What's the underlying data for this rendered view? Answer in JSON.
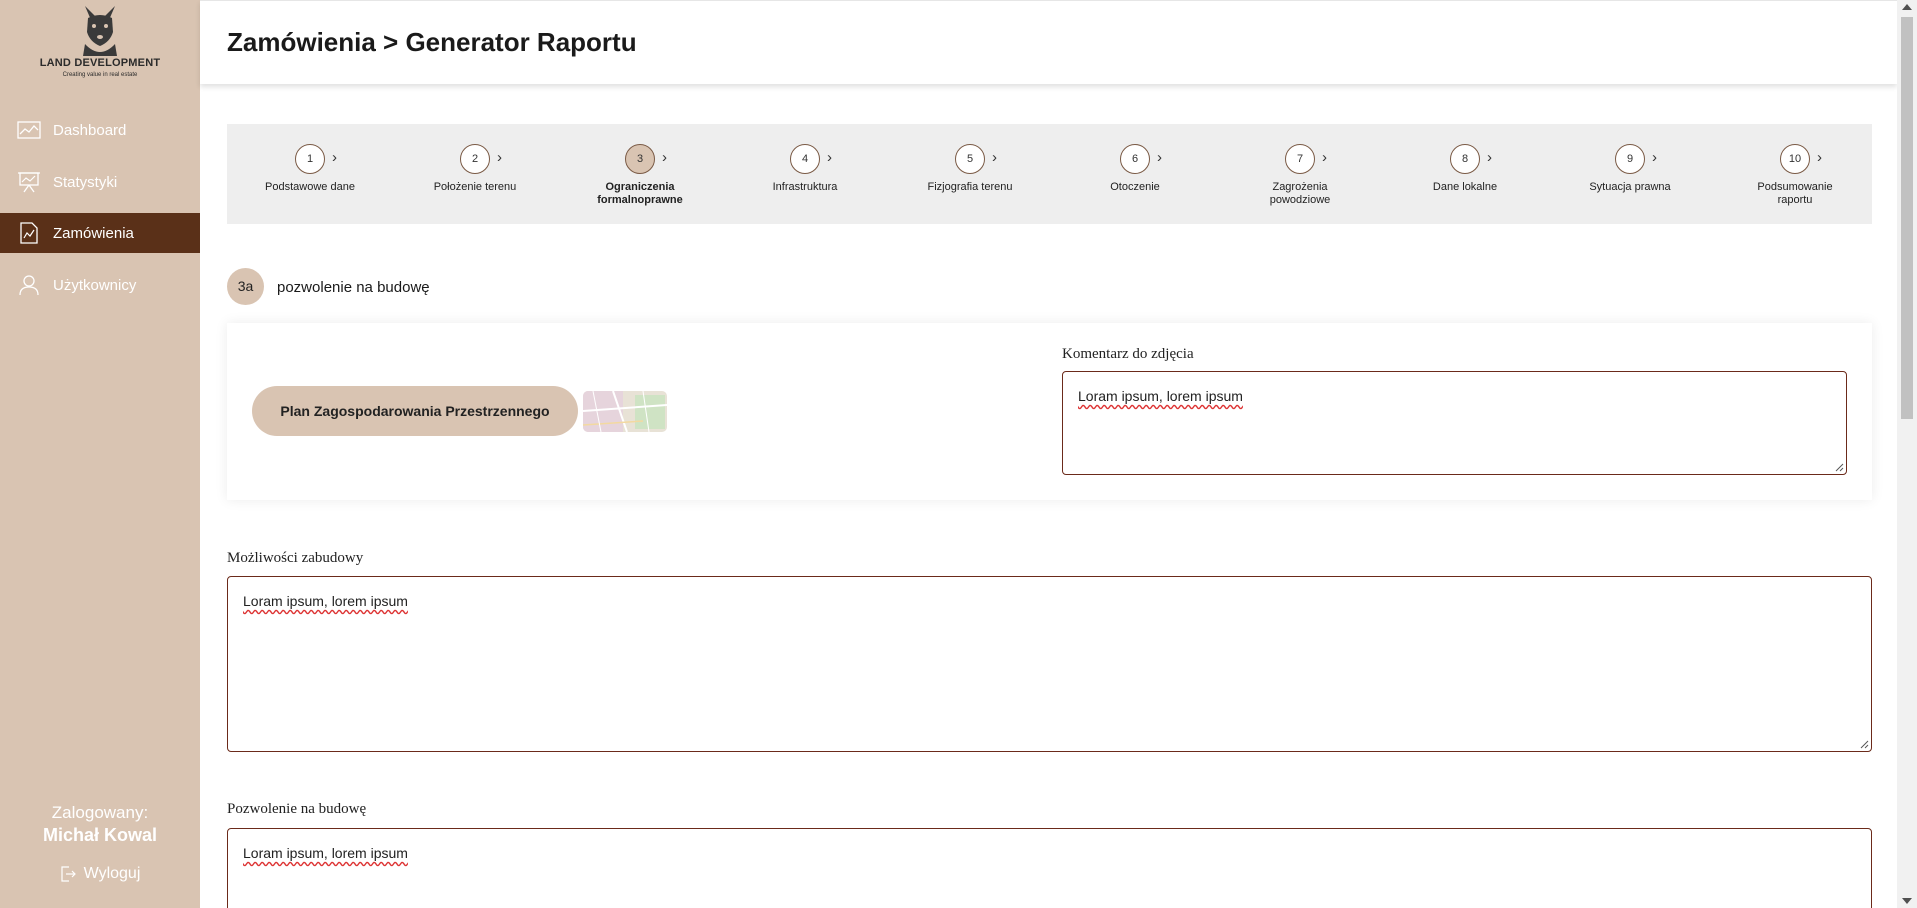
{
  "brand": {
    "name": "LAND DEVELOPMENT",
    "tagline": "Creating value in real estate"
  },
  "sidebar": {
    "items": [
      {
        "label": "Dashboard",
        "icon": "chart-line-icon",
        "active": false
      },
      {
        "label": "Statystyki",
        "icon": "presentation-board-icon",
        "active": false
      },
      {
        "label": "Zamówienia",
        "icon": "document-chart-icon",
        "active": true
      },
      {
        "label": "Użytkownicy",
        "icon": "user-icon",
        "active": false
      }
    ],
    "user_label": "Zalogowany:",
    "user_name": "Michał Kowal",
    "logout_label": "Wyloguj"
  },
  "header": {
    "title": "Zamówienia > Generator Raportu"
  },
  "steps": [
    {
      "number": "1",
      "label": "Podstawowe dane"
    },
    {
      "number": "2",
      "label": "Położenie terenu"
    },
    {
      "number": "3",
      "label": "Ograniczenia formalnoprawne",
      "active": true
    },
    {
      "number": "4",
      "label": "Infrastruktura"
    },
    {
      "number": "5",
      "label": "Fizjografia terenu"
    },
    {
      "number": "6",
      "label": "Otoczenie"
    },
    {
      "number": "7",
      "label": "Zagrożenia powodziowe"
    },
    {
      "number": "8",
      "label": "Dane lokalne"
    },
    {
      "number": "9",
      "label": "Sytuacja prawna"
    },
    {
      "number": "10",
      "label": "Podsumowanie raportu"
    }
  ],
  "section": {
    "badge": "3a",
    "title": "pozwolenie na budowę",
    "plan_button": "Plan Zagospodarowania Przestrzennego",
    "comment_label": "Komentarz do zdjęcia",
    "comment_value": "Loram ipsum, lorem ipsum"
  },
  "fields": {
    "mozliwosci_label": "Możliwości zabudowy",
    "mozliwosci_value": "Loram ipsum, lorem ipsum",
    "pozwolenie_label": "Pozwolenie na budowę",
    "pozwolenie_value": "Loram ipsum, lorem ipsum"
  },
  "colors": {
    "sidebar": "#d9c4b2",
    "active_nav": "#5a3018",
    "accent": "#d9c4b2",
    "border": "#6b2a1a"
  }
}
